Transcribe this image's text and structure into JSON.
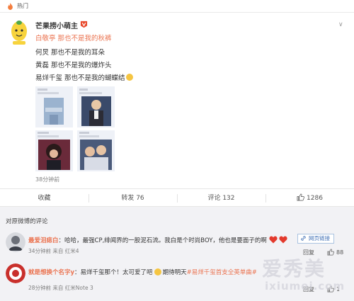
{
  "topbar": {
    "label": "热门"
  },
  "post": {
    "username": "芒果捞小萌主",
    "lines": [
      "白敬亭 那也不是我的秋裤",
      "何炅 那也不是我的耳朵",
      "黄磊 那也不是我的爆炸头",
      "易烊千玺 那也不是我的蝴蝶结"
    ],
    "time": "38分钟前"
  },
  "actions": {
    "favorite": "收藏",
    "repost": "转发 76",
    "comment": "评论 132",
    "like": "1286"
  },
  "comments": {
    "header": "对原微博的评论",
    "items": [
      {
        "user": "最爱泪痣白",
        "text": "：哈哈，最强CP,绯闻界的一股泥石流。我白是个时尚BOY，他也是要面子的啊",
        "time": "34分钟前 来自 红米4",
        "webpage": "网页链接",
        "reply": "回复",
        "likes": "88"
      },
      {
        "user": "就是想换个名字y",
        "text_before": "：易烊千玺那个！太可爱了吧",
        "text_after": "期待明天",
        "tag": "#易烊千玺首支全英单曲#",
        "time": "28分钟前 来自 红米Note 3",
        "reply": "回复",
        "likes": "1"
      }
    ]
  },
  "watermark": {
    "cn": "爱秀美",
    "en": "ixiumei.com"
  },
  "colors": {
    "accent": "#eb7350",
    "link": "#3b6cb3",
    "comment_bg": "#f2f2f5"
  }
}
